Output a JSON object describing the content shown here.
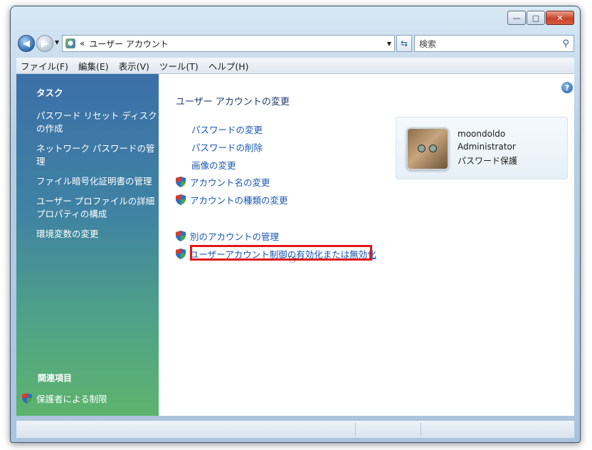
{
  "window": {
    "minimize_symbol": "—",
    "maximize_symbol": "□",
    "close_symbol": "✕"
  },
  "address": {
    "chevron": "«",
    "breadcrumb": "ユーザー アカウント",
    "search_placeholder": "検索"
  },
  "menu": [
    "ファイル(F)",
    "編集(E)",
    "表示(V)",
    "ツール(T)",
    "ヘルプ(H)"
  ],
  "sidebar": {
    "title": "タスク",
    "items": [
      "パスワード リセット ディスクの作成",
      "ネットワーク パスワードの管理",
      "ファイル暗号化証明書の管理",
      "ユーザー プロファイルの詳細プロパティの構成",
      "環境変数の変更"
    ],
    "related_title": "関連項目",
    "related_item": "保護者による制限"
  },
  "main": {
    "title": "ユーザー アカウントの変更",
    "links": [
      "パスワードの変更",
      "パスワードの削除",
      "画像の変更"
    ],
    "shield_links": [
      "アカウント名の変更",
      "アカウントの種類の変更"
    ],
    "other_links": [
      "別のアカウントの管理",
      "ユーザーアカウント制御の有効化または無効化"
    ]
  },
  "account": {
    "name": "moondoldo",
    "type": "Administrator",
    "status": "パスワード保護"
  },
  "colors": {
    "link": "#1a58b4",
    "highlight": "#e01818"
  }
}
